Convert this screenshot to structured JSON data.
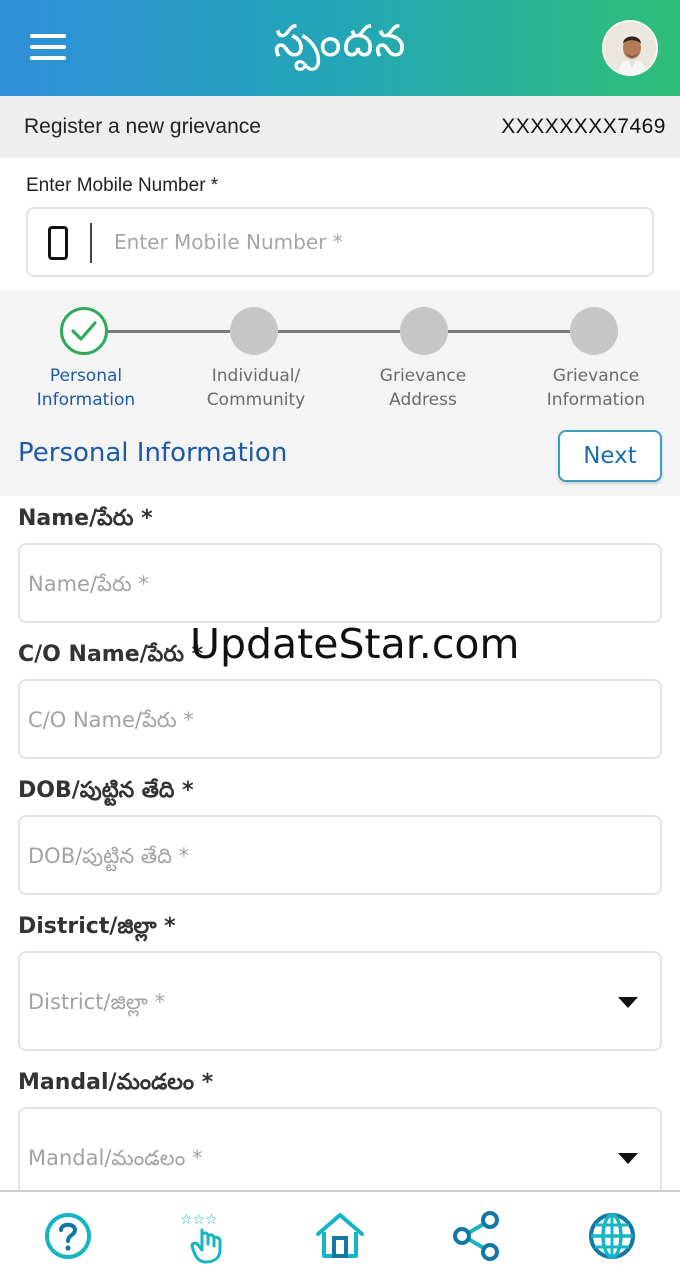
{
  "header": {
    "title": "స్పందన",
    "menu_icon": "hamburger-icon",
    "avatar_icon": "user-avatar"
  },
  "subheader": {
    "title": "Register a new grievance",
    "id": "XXXXXXXX7469"
  },
  "mobile": {
    "label": "Enter Mobile Number *",
    "placeholder": "Enter Mobile Number *",
    "value": ""
  },
  "stepper": {
    "steps": [
      {
        "label": "Personal Information",
        "status": "complete"
      },
      {
        "label": "Individual/ Community",
        "status": "pending"
      },
      {
        "label": "Grievance Address",
        "status": "pending"
      },
      {
        "label": "Grievance Information",
        "status": "pending"
      }
    ]
  },
  "section": {
    "title": "Personal Information",
    "next_label": "Next"
  },
  "form": {
    "fields": [
      {
        "label": "Name/పేరు *",
        "placeholder": "Name/పేరు *",
        "type": "text"
      },
      {
        "label": "C/O Name/పేరు *",
        "placeholder": "C/O Name/పేరు *",
        "type": "text"
      },
      {
        "label": "DOB/పుట్టిన తేది *",
        "placeholder": "DOB/పుట్టిన తేది *",
        "type": "text"
      },
      {
        "label": "District/జిల్లా *",
        "placeholder": "District/జిల్లా *",
        "type": "select"
      },
      {
        "label": "Mandal/మండలం *",
        "placeholder": "Mandal/మండలం *",
        "type": "select"
      }
    ]
  },
  "watermark": "UpdateStar.com",
  "bottom_nav": [
    {
      "icon": "help-icon"
    },
    {
      "icon": "rating-icon"
    },
    {
      "icon": "home-icon"
    },
    {
      "icon": "share-icon"
    },
    {
      "icon": "globe-icon"
    }
  ],
  "colors": {
    "accent": "#1d5aa6",
    "success": "#2eaa5a",
    "teal": "#16b5c6"
  }
}
